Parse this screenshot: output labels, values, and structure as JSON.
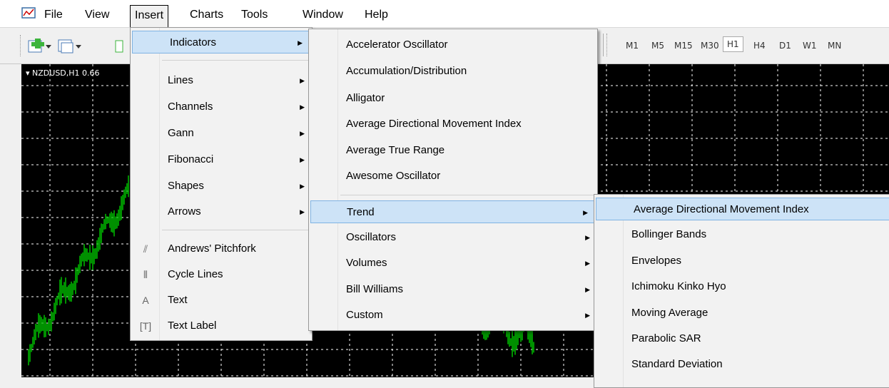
{
  "menubar": {
    "items": [
      "File",
      "View",
      "Insert",
      "Charts",
      "Tools",
      "Window",
      "Help"
    ]
  },
  "toolbar": {
    "timeframes": [
      "M1",
      "M5",
      "M15",
      "M30",
      "H1",
      "H4",
      "D1",
      "W1",
      "MN"
    ],
    "selected_timeframe": "H1"
  },
  "chart": {
    "title": "NZDUSD,H1 0.66"
  },
  "insert_menu": {
    "items": [
      {
        "label": "Indicators",
        "submenu": true
      },
      {
        "label": "Lines",
        "submenu": true
      },
      {
        "label": "Channels",
        "submenu": true
      },
      {
        "label": "Gann",
        "submenu": true
      },
      {
        "label": "Fibonacci",
        "submenu": true
      },
      {
        "label": "Shapes",
        "submenu": true
      },
      {
        "label": "Arrows",
        "submenu": true
      },
      {
        "label": "Andrews' Pitchfork",
        "icon": "pitchfork-icon"
      },
      {
        "label": "Cycle Lines",
        "icon": "cycle-lines-icon"
      },
      {
        "label": "Text",
        "icon": "text-icon"
      },
      {
        "label": "Text Label",
        "icon": "text-label-icon"
      }
    ]
  },
  "indicators_menu": {
    "items": [
      "Accelerator Oscillator",
      "Accumulation/Distribution",
      "Alligator",
      "Average Directional Movement Index",
      "Average True Range",
      "Awesome Oscillator"
    ],
    "groups": [
      "Trend",
      "Oscillators",
      "Volumes",
      "Bill Williams",
      "Custom"
    ]
  },
  "trend_menu": {
    "items": [
      "Average Directional Movement Index",
      "Bollinger Bands",
      "Envelopes",
      "Ichimoku Kinko Hyo",
      "Moving Average",
      "Parabolic SAR",
      "Standard Deviation"
    ]
  },
  "colors": {
    "chart_bg": "#000000",
    "candle": "#00c000",
    "highlight": "#cde3f7"
  }
}
